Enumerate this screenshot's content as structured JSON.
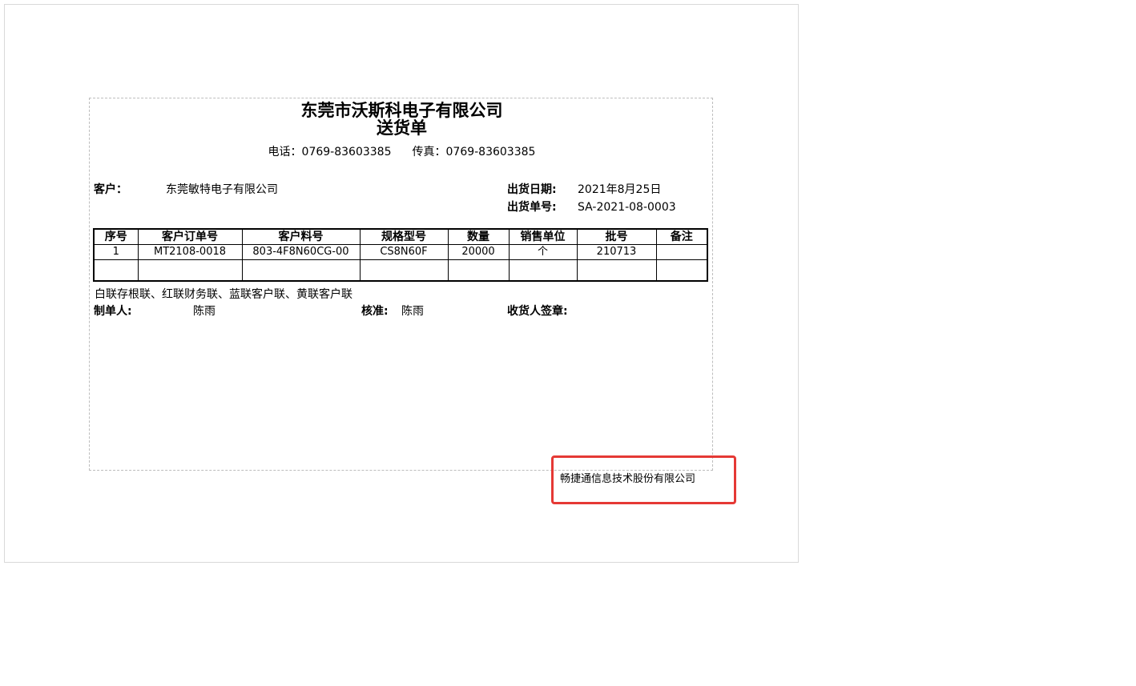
{
  "document": {
    "company_title": "东莞市沃斯科电子有限公司",
    "doc_title": "送货单",
    "phone_label": "电话：",
    "phone": "0769-83603385",
    "fax_label": "传真：",
    "fax": "0769-83603385",
    "customer_label": "客户：",
    "customer": "东莞敏特电子有限公司",
    "ship_date_label": "出货日期:",
    "ship_date": "2021年8月25日",
    "ship_no_label": "出货单号:",
    "ship_no": "SA-2021-08-0003"
  },
  "table": {
    "headers": [
      "序号",
      "客户订单号",
      "客户料号",
      "规格型号",
      "数量",
      "销售单位",
      "批号",
      "备注"
    ],
    "rows": [
      [
        "1",
        "MT2108-0018",
        "803-4F8N60CG-00",
        "CS8N60F",
        "20000",
        "个",
        "210713",
        ""
      ]
    ]
  },
  "footer": {
    "copies_note": "白联存根联、红联财务联、蓝联客户联、黄联客户联",
    "maker_label": "制单人:",
    "maker": "陈雨",
    "checker_label": "核准:",
    "checker": "陈雨",
    "receiver_label": "收货人签章:"
  },
  "vendor": {
    "name": "畅捷通信息技术股份有限公司"
  },
  "colors": {
    "highlight_border": "#e53935",
    "print_area_border": "#bdbdbd"
  }
}
